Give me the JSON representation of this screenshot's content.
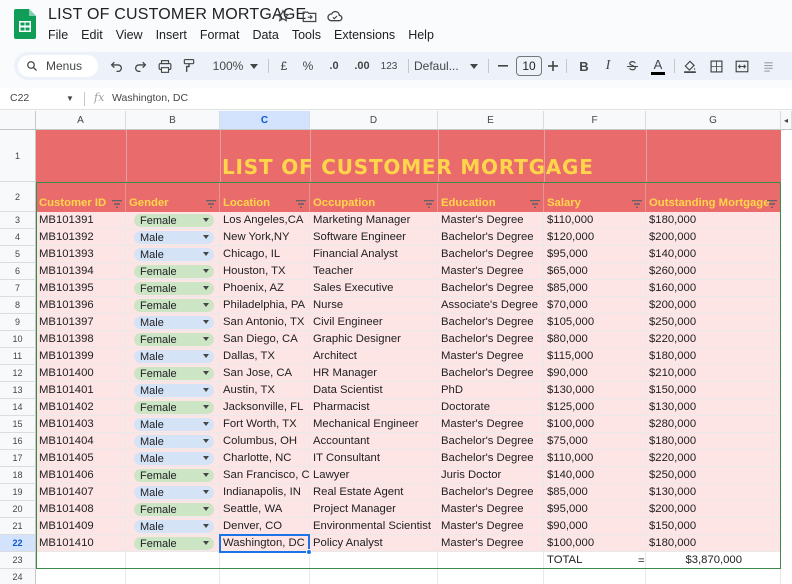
{
  "app": {
    "title": "LIST OF CUSTOMER MORTGAGE",
    "menu": [
      "File",
      "Edit",
      "View",
      "Insert",
      "Format",
      "Data",
      "Tools",
      "Extensions",
      "Help"
    ]
  },
  "toolbar": {
    "menus_label": "Menus",
    "zoom": "100%",
    "currency": "£",
    "percent": "%",
    "dec_decrease": ".0",
    "dec_increase": ".00",
    "number_format": "123",
    "font": "Defaul...",
    "font_size": "10",
    "bold": "B",
    "italic": "I",
    "text_color": "A"
  },
  "formula_bar": {
    "cell_ref": "C22",
    "fx": "fx",
    "value": "Washington, DC"
  },
  "columns": [
    "A",
    "B",
    "C",
    "D",
    "E",
    "F",
    "G"
  ],
  "rows": [
    "1",
    "2",
    "3",
    "4",
    "5",
    "6",
    "7",
    "8",
    "9",
    "10",
    "11",
    "12",
    "13",
    "14",
    "15",
    "16",
    "17",
    "18",
    "19",
    "20",
    "21",
    "22",
    "23",
    "24"
  ],
  "sheet": {
    "title": "LIST OF CUSTOMER MORTGAGE",
    "headers": [
      "Customer ID",
      "Gender",
      "Location",
      "Occupation",
      "Education",
      "Salary",
      "Outstanding Mortgage"
    ],
    "data": [
      [
        "MB101391",
        "Female",
        "Los Angeles,CA",
        "Marketing Manager",
        "Master's Degree",
        "$110,000",
        "$180,000"
      ],
      [
        "MB101392",
        "Male",
        "New York,NY",
        "Software Engineer",
        "Bachelor's Degree",
        "$120,000",
        "$200,000"
      ],
      [
        "MB101393",
        "Male",
        "Chicago, IL",
        "Financial Analyst",
        "Bachelor's Degree",
        "$95,000",
        "$140,000"
      ],
      [
        "MB101394",
        "Female",
        "Houston, TX",
        "Teacher",
        "Master's Degree",
        "$65,000",
        "$260,000"
      ],
      [
        "MB101395",
        "Female",
        "Phoenix, AZ",
        "Sales Executive",
        "Bachelor's Degree",
        "$85,000",
        "$160,000"
      ],
      [
        "MB101396",
        "Female",
        "Philadelphia, PA",
        "Nurse",
        "Associate's Degree",
        "$70,000",
        "$200,000"
      ],
      [
        "MB101397",
        "Male",
        "San Antonio, TX",
        "Civil Engineer",
        "Bachelor's Degree",
        "$105,000",
        "$250,000"
      ],
      [
        "MB101398",
        "Female",
        "San Diego, CA",
        "Graphic Designer",
        "Bachelor's Degree",
        "$80,000",
        "$220,000"
      ],
      [
        "MB101399",
        "Male",
        "Dallas, TX",
        "Architect",
        "Master's Degree",
        "$115,000",
        "$180,000"
      ],
      [
        "MB101400",
        "Female",
        "San Jose, CA",
        "HR Manager",
        "Bachelor's Degree",
        "$90,000",
        "$210,000"
      ],
      [
        "MB101401",
        "Male",
        "Austin, TX",
        "Data Scientist",
        "PhD",
        "$130,000",
        "$150,000"
      ],
      [
        "MB101402",
        "Female",
        "Jacksonville, FL",
        "Pharmacist",
        "Doctorate",
        "$125,000",
        "$130,000"
      ],
      [
        "MB101403",
        "Male",
        "Fort Worth, TX",
        "Mechanical Engineer",
        "Master's Degree",
        "$100,000",
        "$280,000"
      ],
      [
        "MB101404",
        "Male",
        "Columbus, OH",
        "Accountant",
        "Bachelor's Degree",
        "$75,000",
        "$180,000"
      ],
      [
        "MB101405",
        "Male",
        "Charlotte, NC",
        "IT Consultant",
        "Bachelor's Degree",
        "$110,000",
        "$220,000"
      ],
      [
        "MB101406",
        "Female",
        "San Francisco, CA",
        "Lawyer",
        "Juris Doctor",
        "$140,000",
        "$250,000"
      ],
      [
        "MB101407",
        "Male",
        "Indianapolis, IN",
        "Real Estate Agent",
        "Bachelor's Degree",
        "$85,000",
        "$130,000"
      ],
      [
        "MB101408",
        "Female",
        "Seattle, WA",
        "Project Manager",
        "Master's Degree",
        "$95,000",
        "$200,000"
      ],
      [
        "MB101409",
        "Male",
        "Denver, CO",
        "Environmental Scientist",
        "Master's Degree",
        "$90,000",
        "$150,000"
      ],
      [
        "MB101410",
        "Female",
        "Washington, DC",
        "Policy Analyst",
        "Master's Degree",
        "$100,000",
        "$180,000"
      ]
    ],
    "total_label": "TOTAL",
    "total_eq": "=",
    "total_value": "$3,870,000"
  },
  "colors": {
    "title_band": "#ea6b6b",
    "title_text": "#ffd64a",
    "row_band": "#fde5e5",
    "female_chip": "#cce5c5",
    "male_chip": "#d5e3f7",
    "selection": "#1a73e8"
  },
  "icons": [
    "sheets-logo-icon",
    "star-icon",
    "move-folder-icon",
    "cloud-saved-icon",
    "search-icon",
    "undo-icon",
    "redo-icon",
    "print-icon",
    "paint-format-icon",
    "fill-color-icon",
    "borders-icon",
    "merge-cells-icon",
    "filter-icon",
    "dropdown-caret-icon"
  ]
}
